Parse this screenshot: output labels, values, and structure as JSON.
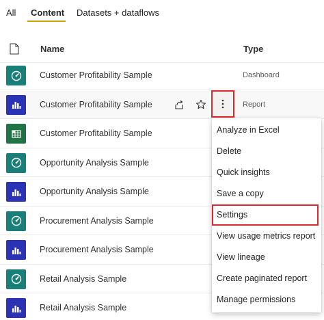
{
  "tabs": [
    {
      "label": "All"
    },
    {
      "label": "Content",
      "active": true
    },
    {
      "label": "Datasets + dataflows"
    }
  ],
  "table": {
    "columns": {
      "name": "Name",
      "type": "Type"
    },
    "rows": [
      {
        "name": "Customer Profitability Sample",
        "type": "Dashboard",
        "icon": "dashboard-icon"
      },
      {
        "name": "Customer Profitability Sample",
        "type": "Report",
        "icon": "report-icon"
      },
      {
        "name": "Customer Profitability Sample",
        "type": "",
        "icon": "dataset-icon"
      },
      {
        "name": "Opportunity Analysis Sample",
        "type": "",
        "icon": "dashboard-icon"
      },
      {
        "name": "Opportunity Analysis Sample",
        "type": "",
        "icon": "report-icon"
      },
      {
        "name": "Procurement Analysis Sample",
        "type": "",
        "icon": "dashboard-icon"
      },
      {
        "name": "Procurement Analysis Sample",
        "type": "",
        "icon": "report-icon"
      },
      {
        "name": "Retail Analysis Sample",
        "type": "",
        "icon": "dashboard-icon"
      },
      {
        "name": "Retail Analysis Sample",
        "type": "",
        "icon": "report-icon"
      }
    ]
  },
  "context_menu": {
    "items": [
      {
        "label": "Analyze in Excel"
      },
      {
        "label": "Delete"
      },
      {
        "label": "Quick insights"
      },
      {
        "label": "Save a copy"
      },
      {
        "label": "Settings",
        "highlighted": true
      },
      {
        "label": "View usage metrics report"
      },
      {
        "label": "View lineage"
      },
      {
        "label": "Create paginated report"
      },
      {
        "label": "Manage permissions"
      }
    ]
  },
  "colors": {
    "accent_underline": "#c8a600",
    "highlight_border": "#d62b30",
    "dashboard_icon_bg": "#1b7f79",
    "report_icon_bg": "#2b33b4",
    "dataset_icon_bg": "#217346"
  }
}
